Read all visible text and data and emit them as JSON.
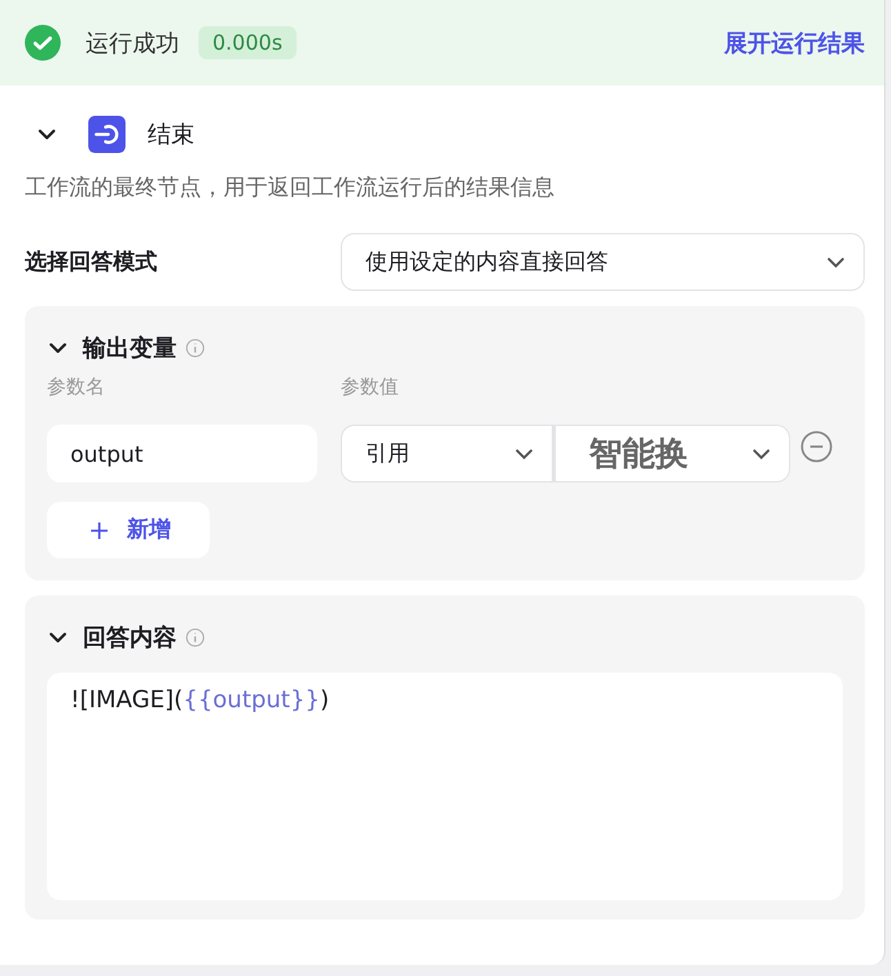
{
  "run_status": {
    "label": "运行成功",
    "duration": "0.000s",
    "link": "展开运行结果",
    "success": true
  },
  "node": {
    "title": "结束",
    "expanded": true,
    "description": "工作流的最终节点，用于返回工作流运行后的结果信息"
  },
  "answer_mode": {
    "label": "选择回答模式",
    "value": "使用设定的内容直接回答"
  },
  "output_variables": {
    "title": "输出变量",
    "expanded": true,
    "columns": [
      "参数名",
      "参数值"
    ],
    "rows": [
      {
        "name": "output",
        "source": "引用",
        "reference": "智能换"
      }
    ],
    "add_button": "新增"
  },
  "answer_content": {
    "title": "回答内容",
    "expanded": true,
    "parts": [
      {
        "kind": "text",
        "text": "![IMAGE]("
      },
      {
        "kind": "variable",
        "text": "{{output}}"
      },
      {
        "kind": "text",
        "text": ")"
      }
    ]
  }
}
